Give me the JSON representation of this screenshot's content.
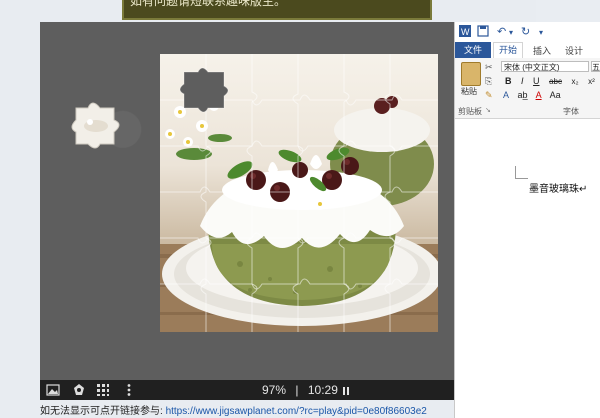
{
  "notice": {
    "text": "如有问题请短联系趣味版主。"
  },
  "puzzle": {
    "zoom": "97%",
    "separator": "|",
    "time": "10:29",
    "pause_icon": "pause-icon",
    "icons": [
      "image-icon",
      "shape-icon",
      "ghost-icon",
      "more-icon"
    ]
  },
  "bottom": {
    "prefix": "如无法显示可点开链接参与:",
    "link": "https://www.jigsawplanet.com/?rc=play&pid=0e80f86603e2"
  },
  "word": {
    "tabs": {
      "file": "文件",
      "home": "开始",
      "insert": "插入",
      "design": "设计"
    },
    "font_name": "宋体 (中文正文)",
    "font_size": "五",
    "paste_label": "粘贴",
    "clipboard_label": "剪贴板",
    "font_label": "字体",
    "format_row1": [
      "B",
      "I",
      "U",
      "abc",
      "x₂",
      "x²"
    ],
    "format_row2": [
      "A",
      "A",
      "Aa"
    ],
    "doc_text": "墨音玻璃珠↵"
  },
  "colors": {
    "notice_bg": "#4b4a1e",
    "word_accent": "#2b579a",
    "link": "#1a56a8"
  }
}
